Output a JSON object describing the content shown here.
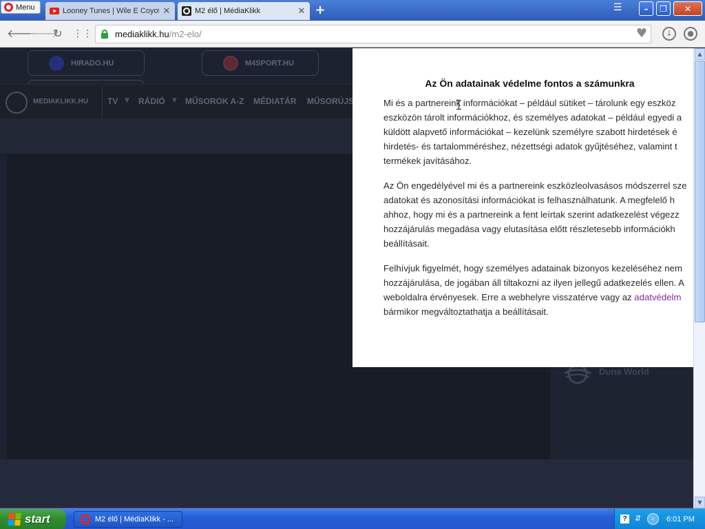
{
  "browser": {
    "menu_label": "Menu",
    "tabs": [
      {
        "label": "Looney Tunes | Wile E Coyot",
        "active": false,
        "icon": "youtube-icon"
      },
      {
        "label": "M2 élő | MédiaKlikk",
        "active": true,
        "icon": "mediaklikk-icon"
      }
    ],
    "url_host": "mediaklikk.hu",
    "url_path": "/m2-elo/"
  },
  "site": {
    "top_links": [
      "HIRADO.HU",
      "M4SPORT.HU"
    ],
    "logo_text": "MEDIAKLIKK.HU",
    "nav": [
      "TV",
      "RÁDIÓ",
      "MŰSOROK A-Z",
      "MÉDIATÁR",
      "MŰSORÚJS"
    ],
    "side_channel": "Duna World"
  },
  "consent": {
    "title": "Az Ön adatainak védelme fontos a számunkra",
    "para1": [
      "Mi és a partnereink információkat – például sütiket – tárolunk egy eszköz",
      "eszközön tárolt információkhoz, és személyes adatokat – például egyedi a",
      "küldött alapvető információkat – kezelünk személyre szabott hirdetések é",
      "hirdetés- és tartalomméréshez, nézettségi adatok gyűjtéséhez, valamint t",
      "termékek javításához."
    ],
    "para2": [
      "Az Ön engedélyével mi és a partnereink eszközleolvasásos módszerrel sze",
      "adatokat és azonosítási információkat is felhasználhatunk. A megfelelő h",
      "ahhoz, hogy mi és a partnereink a fent leírtak szerint adatkezelést végezz",
      "hozzájárulás megadása vagy elutasítása előtt részletesebb információkh",
      "beállításait."
    ],
    "para3": [
      "Felhívjuk figyelmét, hogy személyes adatainak bizonyos kezeléséhez nem",
      "hozzájárulása, de jogában áll tiltakozni az ilyen jellegű adatkezelés ellen. A",
      "weboldalra érvényesek. Erre a webhelyre visszatérve vagy az "
    ],
    "para3_link": "adatvédelm",
    "para3_last": "bármikor megváltoztathatja a beállításait."
  },
  "taskbar": {
    "start_label": "start",
    "task_label": "M2 élő | MédiaKlikk - ...",
    "clock": "6:01 PM"
  },
  "colors": {
    "page_bg": "#1d2230",
    "link": "#7a2d9a",
    "taskbar": "#245ed8",
    "start_green": "#2f8a2f"
  }
}
